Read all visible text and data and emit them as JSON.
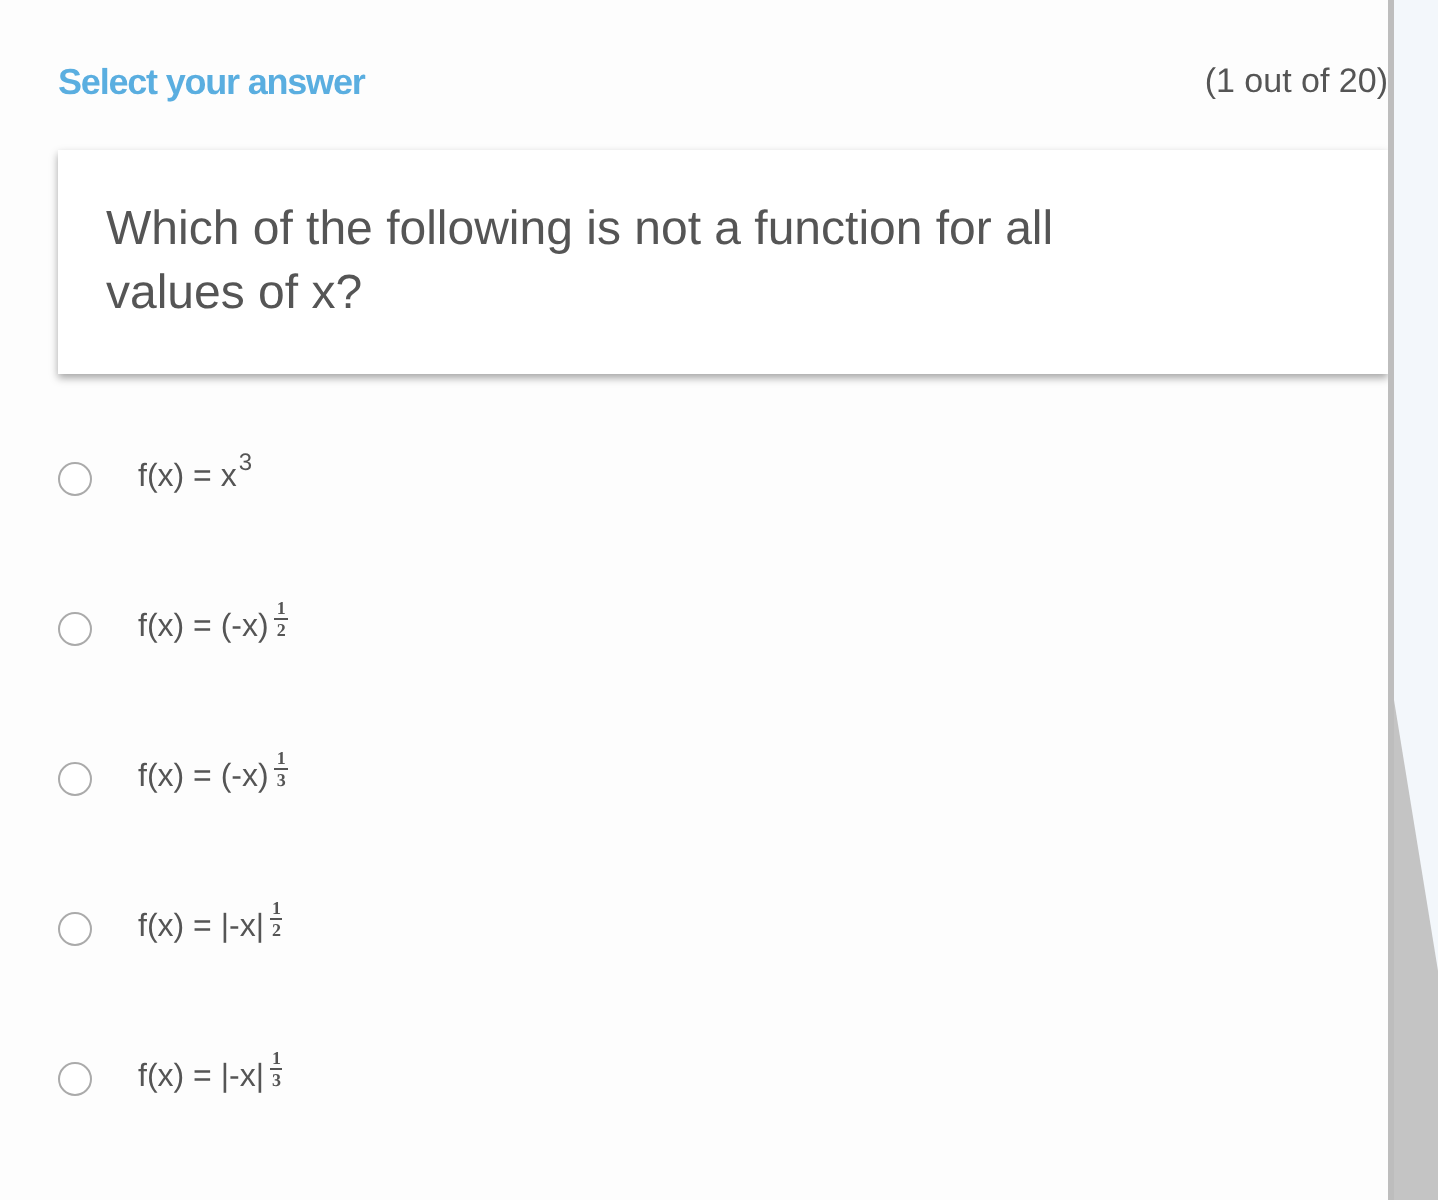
{
  "header": {
    "title": "Select your answer",
    "progress": "(1 out of 20)"
  },
  "question": "Which of the following is not a function for all values of x?",
  "options": [
    {
      "kind": "power",
      "base": "f(x) = x",
      "exponent": "3",
      "selected": false
    },
    {
      "kind": "fraction",
      "base": "f(x) = (-x)",
      "numerator": "1",
      "denominator": "2",
      "selected": false
    },
    {
      "kind": "fraction",
      "base": "f(x) = (-x)",
      "numerator": "1",
      "denominator": "3",
      "selected": false
    },
    {
      "kind": "fraction",
      "base": "f(x) = |-x|",
      "numerator": "1",
      "denominator": "2",
      "selected": false
    },
    {
      "kind": "fraction",
      "base": "f(x) = |-x|",
      "numerator": "1",
      "denominator": "3",
      "selected": false
    }
  ]
}
